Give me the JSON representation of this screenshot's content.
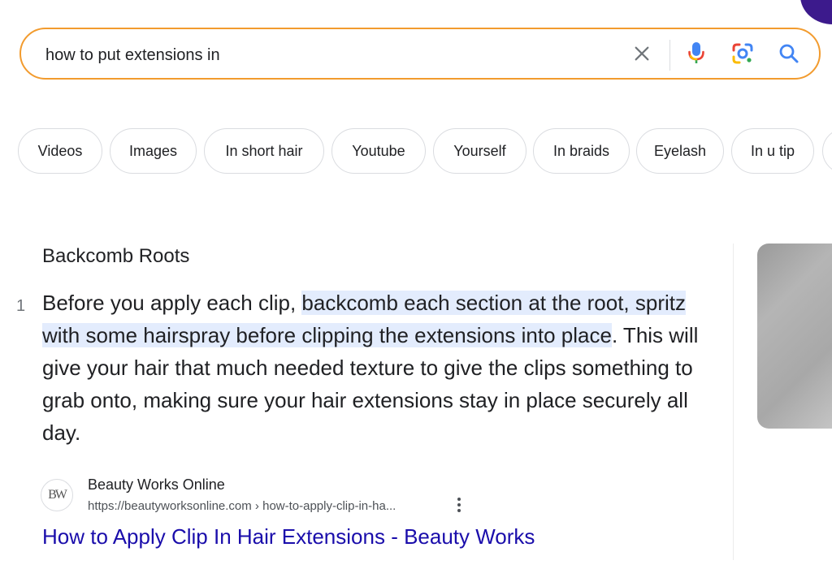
{
  "search": {
    "query": "how to put extensions in"
  },
  "icons": {
    "clear": "close-icon",
    "mic": "mic-icon",
    "lens": "google-lens-icon",
    "search": "search-icon",
    "more": "more-vert-icon"
  },
  "chips": [
    "Videos",
    "Images",
    "In short hair",
    "Youtube",
    "Yourself",
    "In braids",
    "Eyelash",
    "In u tip"
  ],
  "snippet": {
    "heading": "Backcomb Roots",
    "rank": "1",
    "text_before": "Before you apply each clip, ",
    "text_highlight": "backcomb each section at the root, spritz with some hairspray before clipping the extensions into place",
    "text_after": ". This will give your hair that much needed texture to give the clips something to grab onto, making sure your hair extensions stay in place securely all day."
  },
  "source": {
    "favicon_text": "BW",
    "site_name": "Beauty Works Online",
    "url": "https://beautyworksonline.com › how-to-apply-clip-in-ha..."
  },
  "result": {
    "title": "How to Apply Clip In Hair Extensions - Beauty Works"
  },
  "colors": {
    "searchbox_border": "#f29b2e",
    "highlight": "#e3ecfd",
    "link": "#1a0dab",
    "google_blue": "#4285f4",
    "google_red": "#ea4335",
    "google_yellow": "#fbbc04",
    "google_green": "#34a853"
  }
}
